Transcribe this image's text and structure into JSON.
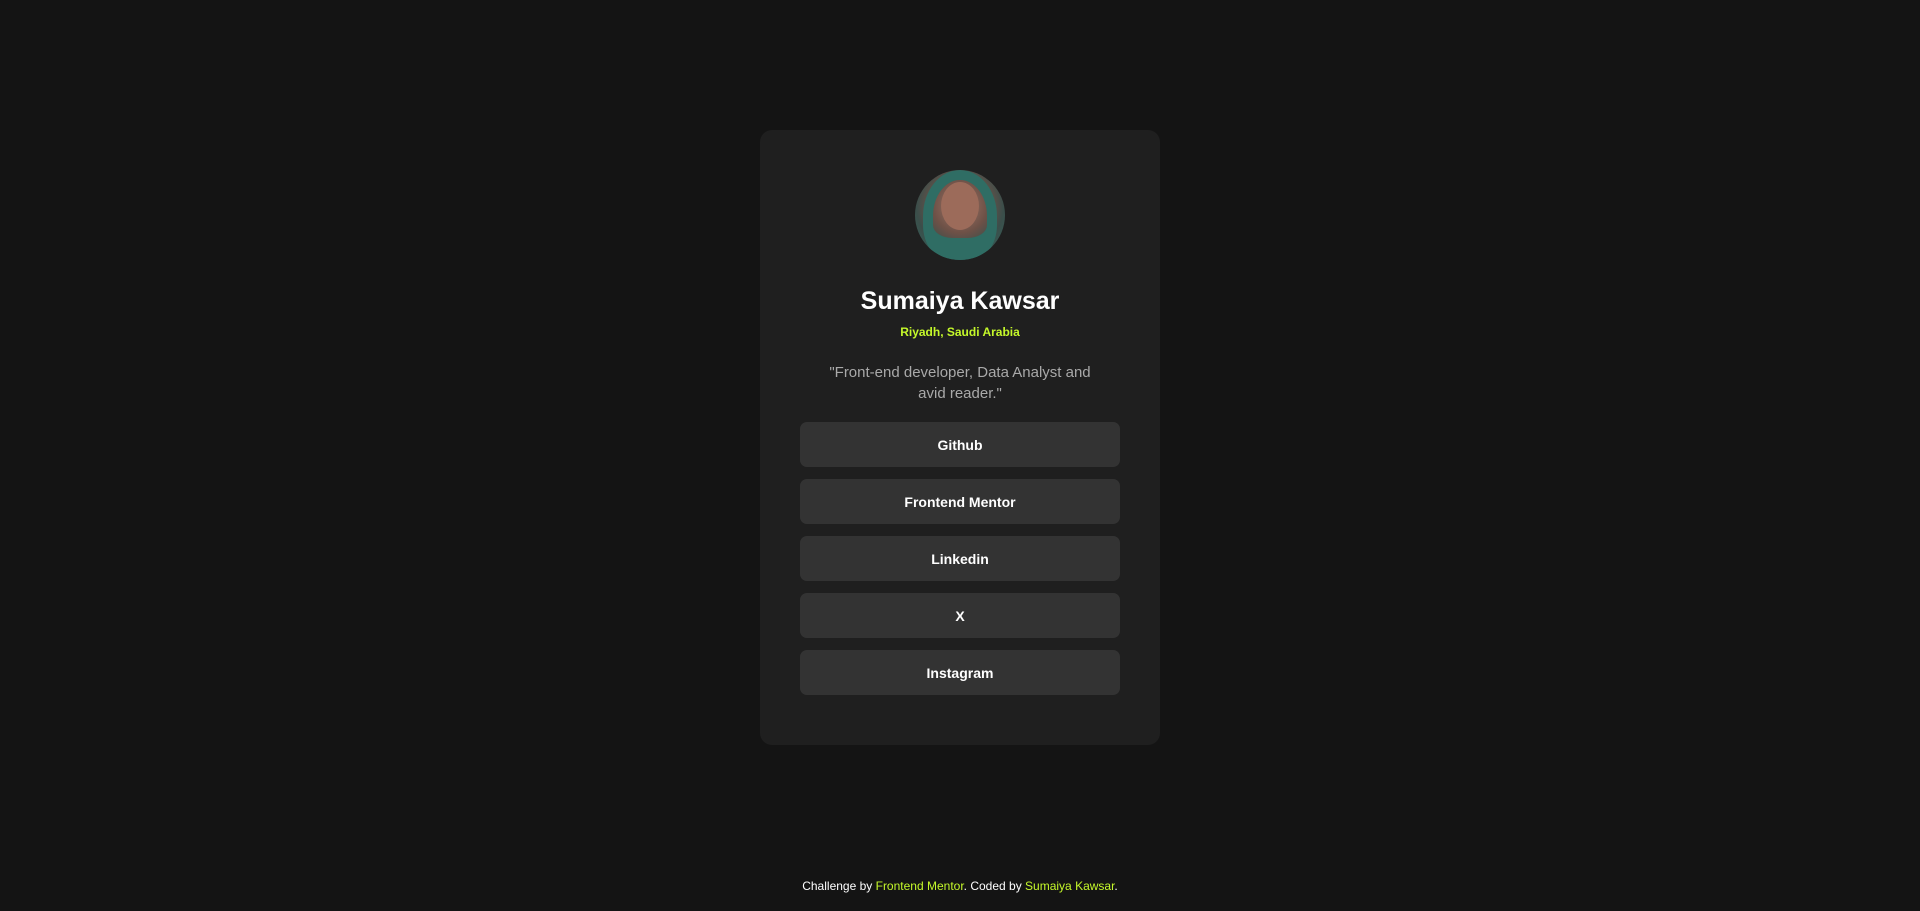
{
  "profile": {
    "name": "Sumaiya Kawsar",
    "location": "Riyadh, Saudi Arabia",
    "bio": "\"Front-end developer, Data Analyst and avid reader.\""
  },
  "links": [
    {
      "label": "Github"
    },
    {
      "label": "Frontend Mentor"
    },
    {
      "label": "Linkedin"
    },
    {
      "label": "X"
    },
    {
      "label": "Instagram"
    }
  ],
  "footer": {
    "prefix": "Challenge by ",
    "challenge_link": "Frontend Mentor",
    "middle": ". Coded by ",
    "author_link": "Sumaiya Kawsar",
    "suffix": "."
  },
  "colors": {
    "accent": "#c4f82a",
    "background": "#141414",
    "card": "#1f1f1f",
    "button": "#333333"
  }
}
